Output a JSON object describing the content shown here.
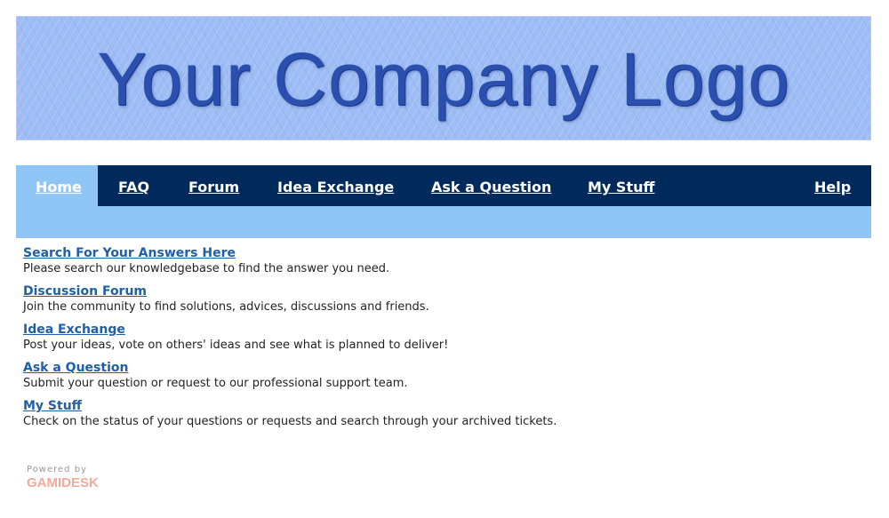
{
  "banner": {
    "logo_text": "Your Company Logo"
  },
  "nav": {
    "tabs": [
      {
        "label": "Home",
        "active": true
      },
      {
        "label": "FAQ",
        "active": false
      },
      {
        "label": "Forum",
        "active": false
      },
      {
        "label": "Idea Exchange",
        "active": false
      },
      {
        "label": "Ask a Question",
        "active": false
      },
      {
        "label": "My Stuff",
        "active": false
      },
      {
        "label": "Help",
        "active": false
      }
    ]
  },
  "main": {
    "items": [
      {
        "title": "Search For Your Answers Here",
        "description": "Please search our knowledgebase to find the answer you need."
      },
      {
        "title": "Discussion Forum",
        "description": "Join the community to find solutions, advices, discussions and friends."
      },
      {
        "title": "Idea Exchange",
        "description": "Post your ideas, vote on others' ideas and see what is planned to deliver!"
      },
      {
        "title": "Ask a Question",
        "description": "Submit your question or request to our professional support team."
      },
      {
        "title": "My Stuff",
        "description": "Check on the status of your questions or requests and search through your archived tickets."
      }
    ]
  },
  "footer": {
    "powered_by": "Powered by",
    "brand": "GAMIDESK"
  },
  "colors": {
    "nav_background": "#002a5c",
    "nav_active": "#8ec5f5",
    "link": "#1f5fa8",
    "banner": "#9ebdf5"
  }
}
